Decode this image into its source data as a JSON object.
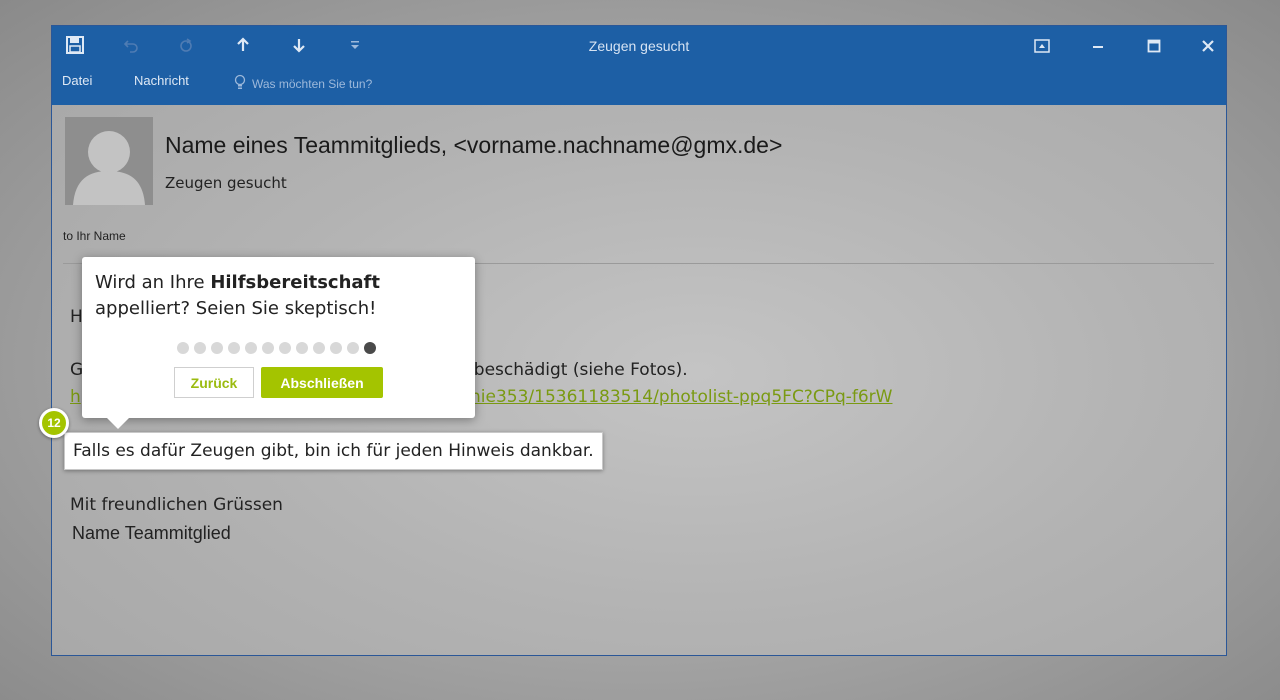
{
  "window": {
    "title": "Zeugen gesucht",
    "menu": {
      "file": "Datei",
      "message": "Nachricht",
      "tell_me": "Was möchten Sie tun?"
    }
  },
  "email": {
    "sender": "Name eines Teammitglieds, <vorname.nachname@gmx.de>",
    "subject": "Zeugen gesucht",
    "to": "to Ihr Name",
    "body": {
      "greeting_fragment": "H",
      "line1_start": "G",
      "line1_end": "o beschädigt (siehe Fotos).",
      "link_start": "h",
      "link_end": "nie353/15361183514/photolist-ppq5FC?CPq-f6rW",
      "highlighted_sentence": "Falls es dafür Zeugen gibt, bin ich für jeden Hinweis dankbar.",
      "closing": "Mit freundlichen Grüssen",
      "signature": "Name Teammitglied"
    }
  },
  "tooltip": {
    "text_before": "Wird an Ihre ",
    "text_bold": "Hilfsbereitschaft",
    "text_after": "appelliert? Seien Sie skeptisch!",
    "step_count": 12,
    "current_step": 12,
    "back_label": "Zurück",
    "finish_label": "Abschließen"
  },
  "step_badge": "12",
  "colors": {
    "titlebar": "#1d5fa5",
    "accent_green": "#a4c400",
    "link_green": "#7a9a12"
  },
  "icons": [
    "save-icon",
    "undo-icon",
    "redo-icon",
    "up-arrow-icon",
    "down-arrow-icon",
    "customize-icon",
    "lightbulb-icon",
    "ribbon-display-icon",
    "minimize-icon",
    "maximize-icon",
    "close-icon",
    "person-silhouette-icon"
  ]
}
